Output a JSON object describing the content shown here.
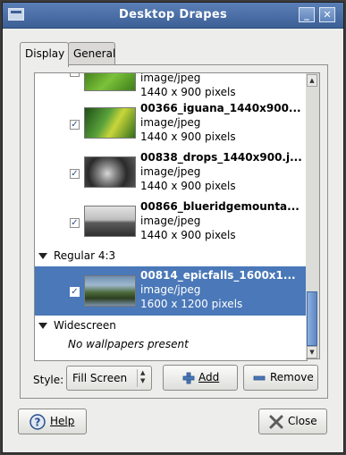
{
  "window": {
    "title": "Desktop Drapes"
  },
  "tabs": [
    {
      "label": "Display"
    },
    {
      "label": "General"
    }
  ],
  "list": {
    "items": [
      {
        "mime": "image/jpeg",
        "size": "1440 x 900 pixels",
        "checked": true
      },
      {
        "name": "00366_iguana_1440x900...",
        "mime": "image/jpeg",
        "size": "1440 x 900 pixels",
        "checked": true
      },
      {
        "name": "00838_drops_1440x900.j...",
        "mime": "image/jpeg",
        "size": "1440 x 900 pixels",
        "checked": true
      },
      {
        "name": "00866_blueridgemounta...",
        "mime": "image/jpeg",
        "size": "1440 x 900 pixels",
        "checked": true
      }
    ],
    "group_regular": "Regular 4:3",
    "regular_items": [
      {
        "name": "00814_epicfalls_1600x1...",
        "mime": "image/jpeg",
        "size": "1600 x 1200 pixels",
        "checked": true,
        "selected": true
      }
    ],
    "group_widescreen": "Widescreen",
    "widescreen_empty": "No wallpapers present"
  },
  "style": {
    "label": "Style:",
    "value": "Fill Screen"
  },
  "buttons": {
    "add": "Add",
    "remove": "Remove",
    "help": "Help",
    "close": "Close"
  },
  "colors": {
    "selection": "#4a78b8",
    "titlebar": "#3c5f96"
  }
}
